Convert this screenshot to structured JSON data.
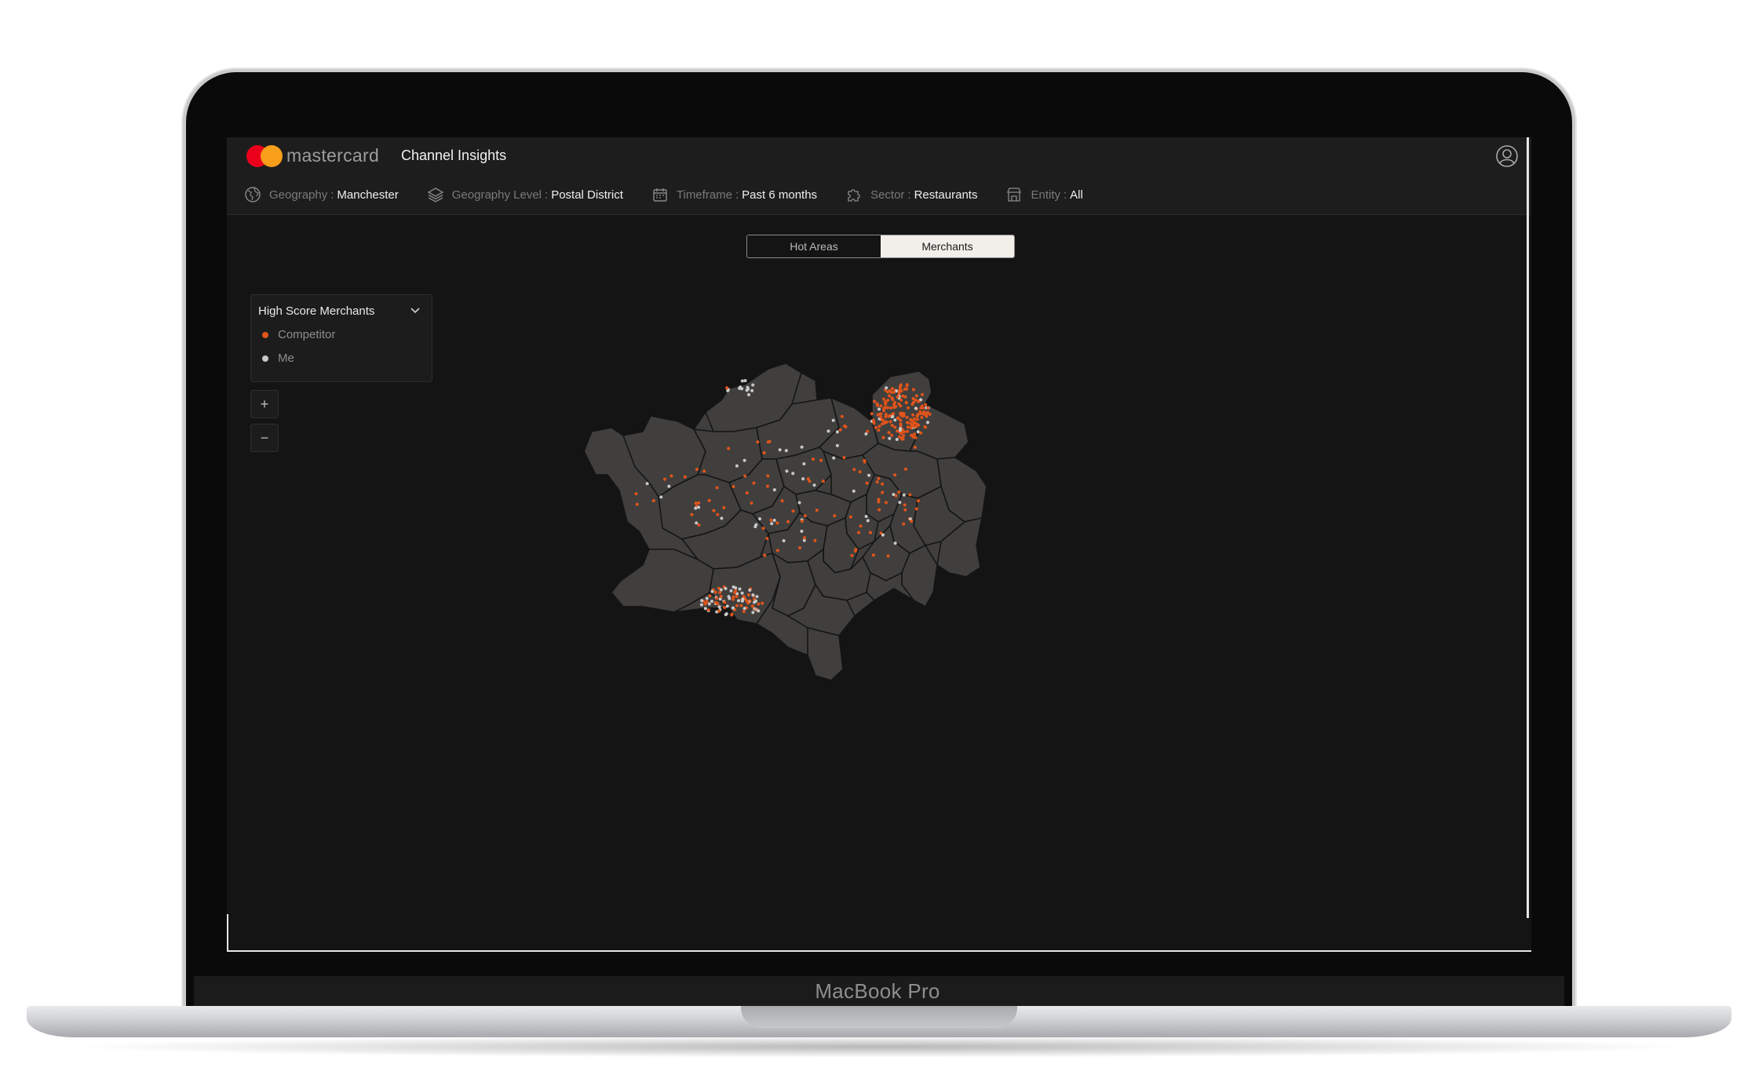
{
  "device": {
    "label": "MacBook Pro"
  },
  "header": {
    "brand": "mastercard",
    "product": "Channel Insights"
  },
  "filters": [
    {
      "label": "Geography",
      "value": "Manchester",
      "icon": "globe-icon"
    },
    {
      "label": "Geography Level",
      "value": "Postal District",
      "icon": "layers-icon"
    },
    {
      "label": "Timeframe",
      "value": "Past 6 months",
      "icon": "calendar-icon"
    },
    {
      "label": "Sector",
      "value": "Restaurants",
      "icon": "puzzle-icon"
    },
    {
      "label": "Entity",
      "value": "All",
      "icon": "store-icon"
    }
  ],
  "view_toggle": {
    "options": [
      "Hot Areas",
      "Merchants"
    ],
    "selected": "Merchants"
  },
  "legend": {
    "title": "High Score Merchants",
    "items": [
      {
        "label": "Competitor",
        "color": "#e0541a"
      },
      {
        "label": "Me",
        "color": "#c8c8c8"
      }
    ]
  },
  "zoom": {
    "in": "+",
    "out": "−"
  },
  "colors": {
    "accent_red": "#eb001b",
    "accent_orange": "#f79e1b",
    "competitor": "#e0541a",
    "me": "#c8c8c8",
    "map_fill": "#403f3e"
  }
}
